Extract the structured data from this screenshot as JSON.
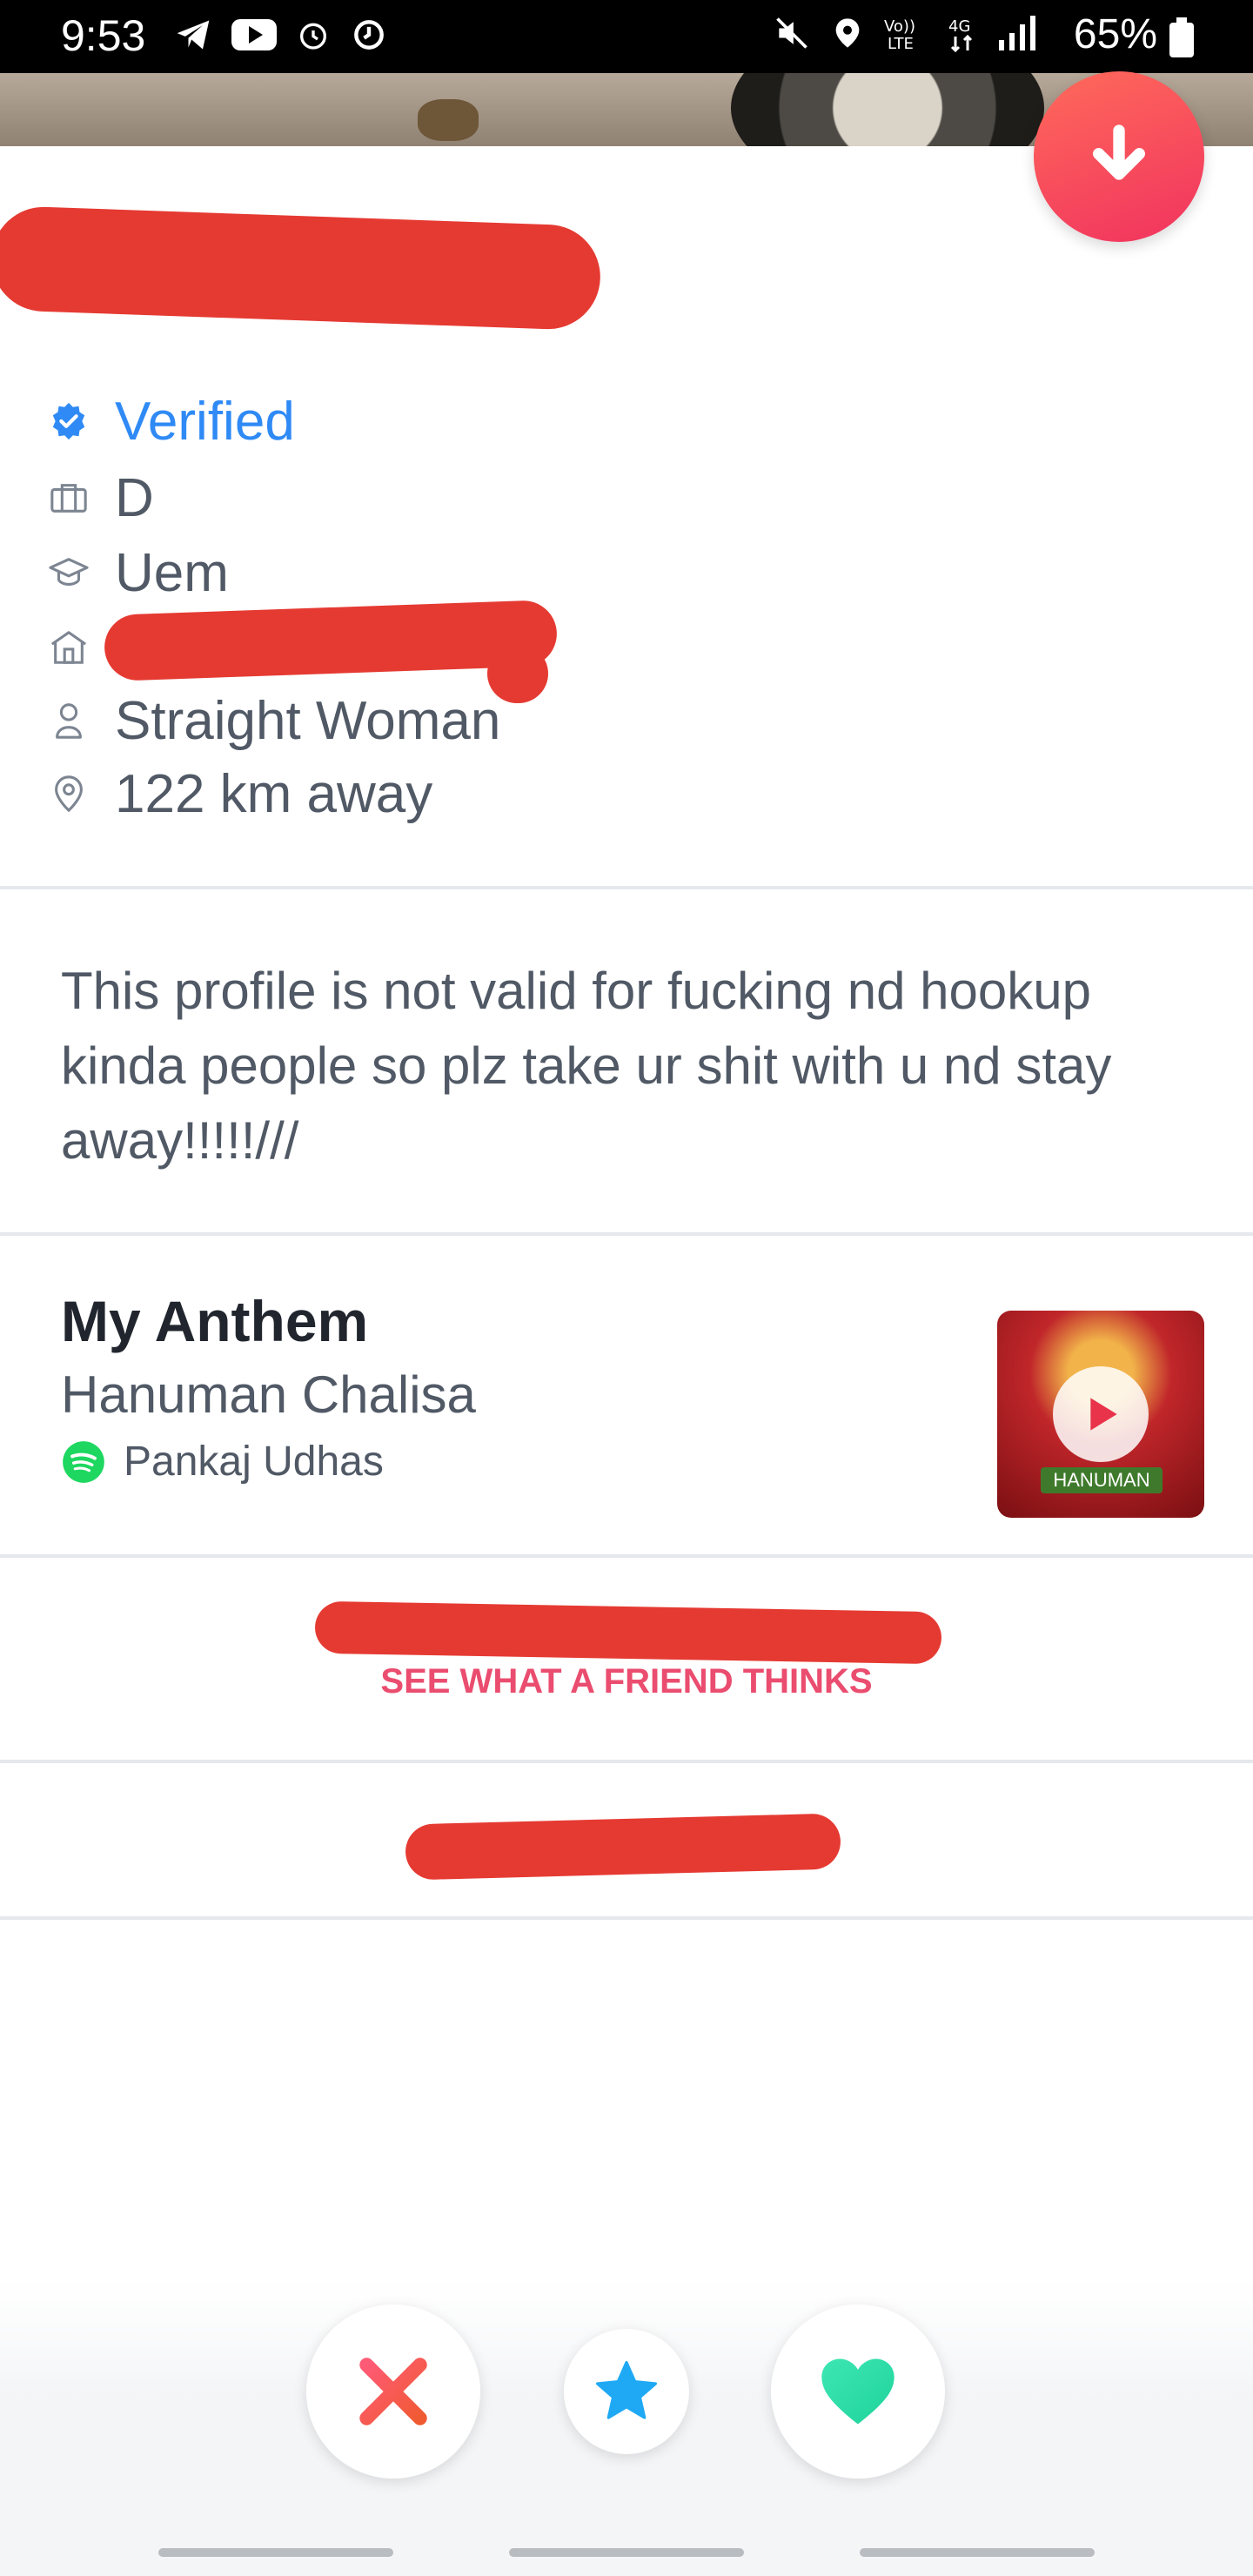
{
  "status_bar": {
    "time": "9:53",
    "battery": "65%"
  },
  "profile": {
    "verified_label": "Verified",
    "job": "D",
    "school": "Uem",
    "orientation": "Straight Woman",
    "distance": "122 km away"
  },
  "bio": "This profile is not valid for fucking nd hookup kinda people so plz take ur shit with u nd stay away!!!!!///",
  "anthem": {
    "heading": "My Anthem",
    "song": "Hanuman Chalisa",
    "artist": "Pankaj Udhas",
    "album_text": "HANUMAN"
  },
  "links": {
    "friend_thinks": "SEE WHAT A FRIEND THINKS"
  },
  "colors": {
    "accent": "#2f8af5",
    "brand": "#f1335f",
    "like": "#2be0a6",
    "superlike": "#1fa9f5",
    "nope": "#f4525f"
  }
}
